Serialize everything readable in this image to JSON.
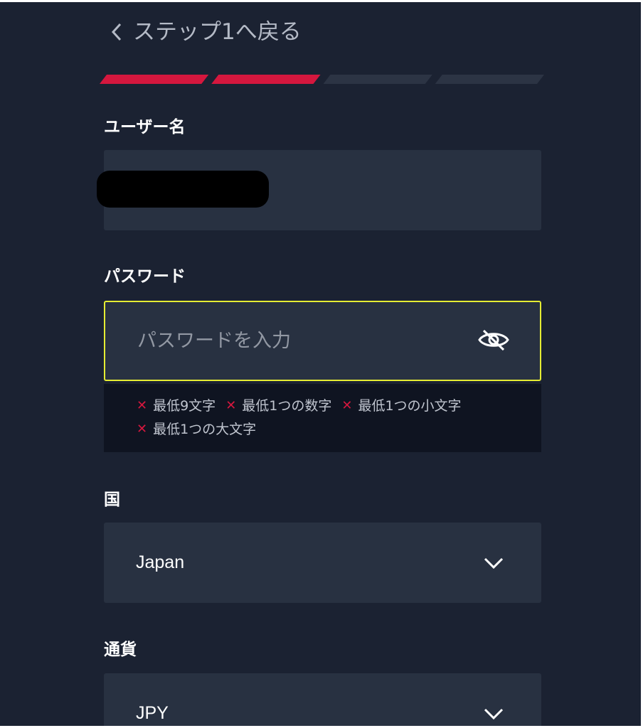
{
  "header": {
    "back_label": "ステップ1へ戻る"
  },
  "progress": {
    "total_steps": 4,
    "completed_steps": 2,
    "active_color": "#d5173e",
    "inactive_color": "#2c3444"
  },
  "username": {
    "label": "ユーザー名"
  },
  "password": {
    "label": "パスワード",
    "placeholder": "パスワードを入力",
    "requirements": [
      "最低9文字",
      "最低1つの数字",
      "最低1つの小文字",
      "最低1つの大文字"
    ],
    "requirement_status_icon": "x-mark-icon"
  },
  "country": {
    "label": "国",
    "value": "Japan"
  },
  "currency": {
    "label": "通貨",
    "value": "JPY"
  }
}
